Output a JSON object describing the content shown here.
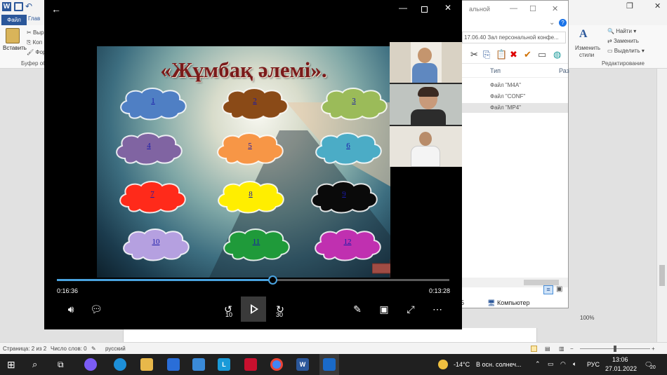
{
  "word": {
    "tab_file": "Файл",
    "tab_home": "Глав",
    "paste_label": "Вставить",
    "cut_label": "Выр",
    "copy_label": "Коп",
    "format_label": "Фор",
    "clipboard_group": "Буфер об",
    "find_label": "Найти",
    "replace_label": "Заменить",
    "select_label": "Выделить",
    "styles_label_1": "Изменить",
    "styles_label_2": "стили",
    "editing_group": "Редактирование",
    "status_page": "Страница: 2 из 2",
    "status_words": "Число слов: 0",
    "status_lang": "русский",
    "zoom_level": "100%"
  },
  "explorer": {
    "title": "альной",
    "address": "17.06.40 Зал персональной конфе...",
    "col_type": "Тип",
    "col_size": "Раз",
    "rows": [
      "Файл \"M4A\"",
      "Файл \"CONF\"",
      "Файл \"MP4\""
    ],
    "computer_label": "Компьютер",
    "left_digit": "5"
  },
  "player": {
    "slide_title": "«Жұмбақ әлемі».",
    "time_elapsed": "0:16:36",
    "time_remaining": "0:13:28",
    "progress": 0.55,
    "rewind_label": "10",
    "forward_label": "30",
    "clouds": [
      {
        "label": "1",
        "color": "#4f7fc4"
      },
      {
        "label": "2",
        "color": "#8a4a17"
      },
      {
        "label": "3",
        "color": "#9bbb59"
      },
      {
        "label": "4",
        "color": "#8064a2"
      },
      {
        "label": "5",
        "color": "#f79646"
      },
      {
        "label": "6",
        "color": "#4bacc6"
      },
      {
        "label": "7",
        "color": "#ff2a1a"
      },
      {
        "label": "8",
        "color": "#ffee00"
      },
      {
        "label": "9",
        "color": "#0a0a0a"
      },
      {
        "label": "10",
        "color": "#b5a0e0"
      },
      {
        "label": "11",
        "color": "#1f9a3a"
      },
      {
        "label": "12",
        "color": "#c030b0"
      }
    ]
  },
  "taskbar": {
    "weather": "-14°C",
    "weather_desc": "В осн. солнеч...",
    "lang": "РУС",
    "time": "13:06",
    "date": "27.01.2022",
    "notifications": "20"
  }
}
